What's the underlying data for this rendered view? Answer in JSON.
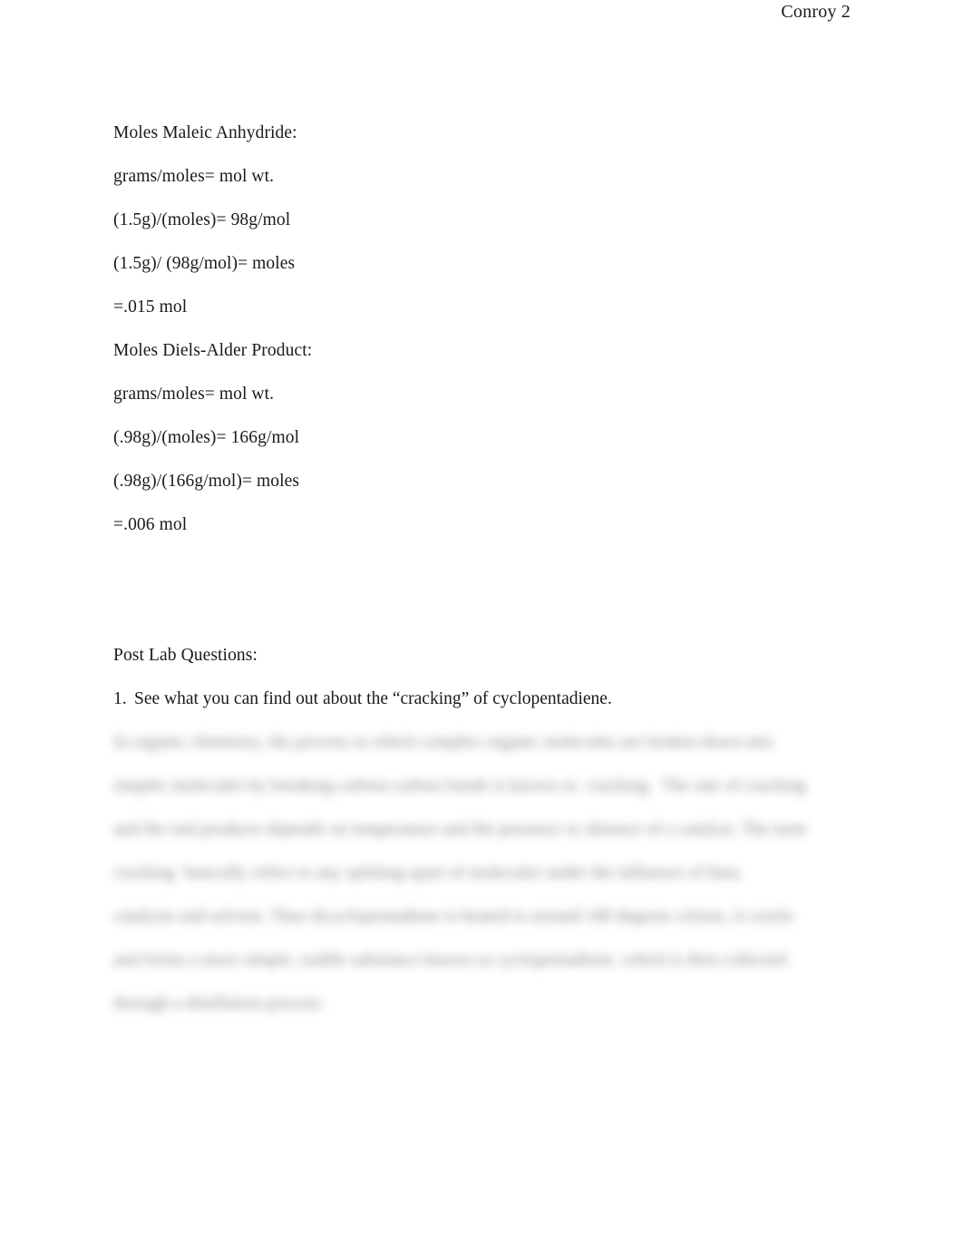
{
  "header": {
    "running_head": "Conroy 2"
  },
  "body": {
    "maleic_anhydride": {
      "heading": "Moles Maleic Anhydride:",
      "lines": [
        "grams/moles= mol wt.",
        "(1.5g)/(moles)= 98g/mol",
        "(1.5g)/ (98g/mol)= moles",
        "=.015 mol"
      ]
    },
    "diels_alder": {
      "heading": "Moles Diels-Alder Product:",
      "lines": [
        "grams/moles= mol wt.",
        "(.98g)/(moles)= 166g/mol",
        "(.98g)/(166g/mol)= moles",
        "=.006 mol"
      ]
    },
    "post_lab": {
      "heading": "Post Lab Questions:",
      "question_number": "1.",
      "question_text": "See what you can find out about the “cracking” of cyclopentadiene.",
      "answer_obscured": true,
      "answer_lines": [
        "In organic chemistry, the process in which complex organic molecules are broken down into",
        "simpler molecules by breaking carbon-carbon bonds is known as  cracking.  The rate of cracking",
        "and the end products depends on temperature and the presence or absence of a catalyst. The term",
        "cracking  basically refers to any splitting apart of molecules under the influence of heat,",
        "catalysts and solvent. Thus dicyclopentadiene is heated to around 180 degrees celsius, it cracks",
        "and forms a more simple, usable substance known as cyclopentadiene, which is then collected",
        "through a distillation process."
      ]
    }
  },
  "colors": {
    "page_background": "#ffffff",
    "text": "#1a1a1a"
  }
}
